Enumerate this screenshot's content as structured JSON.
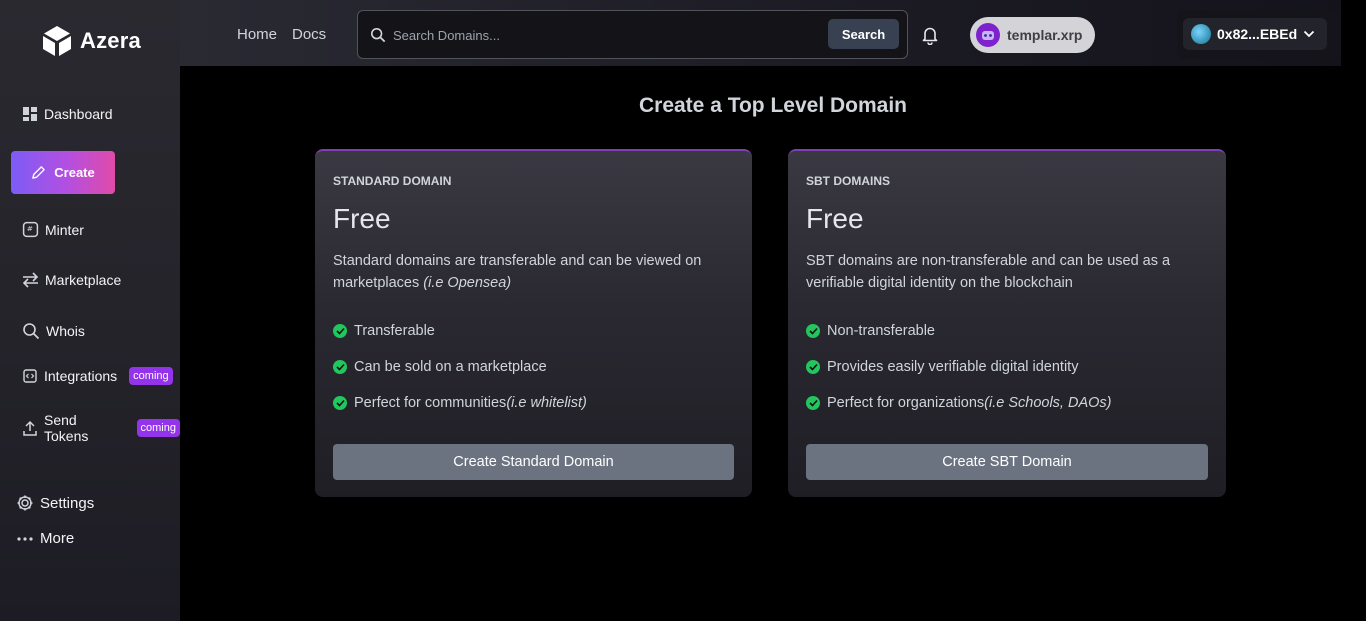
{
  "brand": {
    "name": "Azera"
  },
  "sidebar": {
    "items": [
      {
        "label": "Dashboard",
        "icon": "dashboard-icon"
      },
      {
        "label": "Create",
        "icon": "pencil-icon"
      },
      {
        "label": "Minter",
        "icon": "minter-icon"
      },
      {
        "label": "Marketplace",
        "icon": "swap-arrows-icon"
      },
      {
        "label": "Whois",
        "icon": "search-icon"
      },
      {
        "label": "Integrations",
        "icon": "code-icon",
        "badge": "coming"
      },
      {
        "label": "Send Tokens",
        "icon": "upload-icon",
        "badge": "coming"
      }
    ],
    "bottom": [
      {
        "label": "Settings",
        "icon": "gear-icon"
      },
      {
        "label": "More",
        "icon": "dots-icon"
      }
    ]
  },
  "header": {
    "links": [
      "Home",
      "Docs"
    ],
    "search": {
      "placeholder": "Search Domains...",
      "value": "",
      "button": "Search"
    },
    "user": "templar.xrp",
    "wallet": "0x82...EBEd"
  },
  "main": {
    "title": "Create a Top Level Domain",
    "cards": [
      {
        "label": "STANDARD DOMAIN",
        "price": "Free",
        "desc": "Standard domains are transferable and can be viewed on marketplaces ",
        "desc_em": "(i.e Opensea)",
        "features": [
          {
            "text": "Transferable",
            "em": ""
          },
          {
            "text": "Can be sold on a marketplace",
            "em": ""
          },
          {
            "text": "Perfect for communities",
            "em": "(i.e whitelist)"
          }
        ],
        "button": "Create Standard Domain"
      },
      {
        "label": "SBT DOMAINS",
        "price": "Free",
        "desc": "SBT domains are non-transferable and can be used as a verifiable digital identity on the blockchain",
        "desc_em": "",
        "features": [
          {
            "text": "Non-transferable",
            "em": ""
          },
          {
            "text": "Provides easily verifiable digital identity",
            "em": ""
          },
          {
            "text": "Perfect for organizations",
            "em": "(i.e Schools, DAOs)"
          }
        ],
        "button": "Create SBT Domain"
      }
    ]
  },
  "colors": {
    "accent_start": "#7c5cf6",
    "accent_end": "#e04ba8",
    "badge": "#9333ea",
    "check": "#22c55e"
  }
}
